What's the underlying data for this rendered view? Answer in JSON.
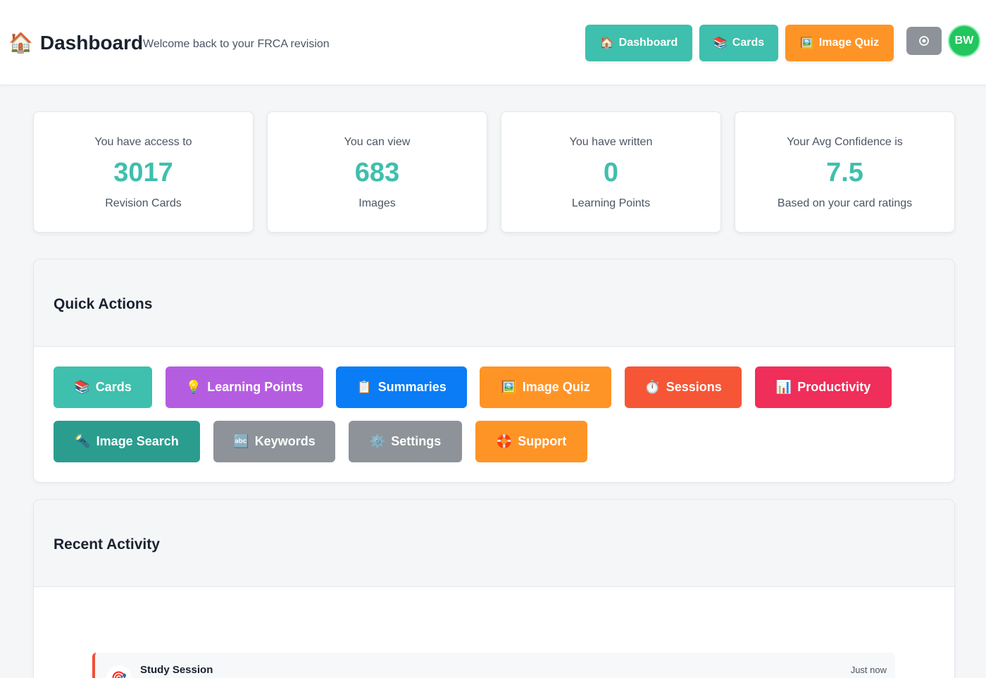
{
  "header": {
    "brand_icon": "🏠",
    "title": "Dashboard",
    "subtitle": "Welcome back to your FRCA revision",
    "nav": [
      {
        "icon": "🏠",
        "label": "Dashboard",
        "color": "#3fbfad"
      },
      {
        "icon": "📚",
        "label": "Cards",
        "color": "#3fbfad"
      },
      {
        "icon": "🖼️",
        "label": "Image Quiz",
        "color": "#ff9426"
      }
    ],
    "toggle_icon": "contrast-icon",
    "avatar_initials": "BW"
  },
  "stats": [
    {
      "label": "You have access to",
      "value": "3017",
      "caption": "Revision Cards"
    },
    {
      "label": "You can view",
      "value": "683",
      "caption": "Images"
    },
    {
      "label": "You have written",
      "value": "0",
      "caption": "Learning Points"
    },
    {
      "label": "Your Avg Confidence is",
      "value": "7.5",
      "caption": "Based on your card ratings"
    }
  ],
  "quick_actions": {
    "title": "Quick Actions",
    "buttons": [
      {
        "icon": "📚",
        "label": "Cards",
        "color": "#3fbfad"
      },
      {
        "icon": "💡",
        "label": "Learning Points",
        "color": "#b55de0"
      },
      {
        "icon": "📋",
        "label": "Summaries",
        "color": "#0a7cf5"
      },
      {
        "icon": "🖼️",
        "label": "Image Quiz",
        "color": "#ff9426"
      },
      {
        "icon": "⏱️",
        "label": "Sessions",
        "color": "#f65636"
      },
      {
        "icon": "📊",
        "label": "Productivity",
        "color": "#ef2e5a"
      },
      {
        "icon": "🔦",
        "label": "Image Search",
        "color": "#2a9d8f"
      },
      {
        "icon": "🔤",
        "label": "Keywords",
        "color": "#8e9399"
      },
      {
        "icon": "⚙️",
        "label": "Settings",
        "color": "#8e9399"
      },
      {
        "icon": "🛟",
        "label": "Support",
        "color": "#ff9426"
      }
    ]
  },
  "recent_activity": {
    "title": "Recent Activity",
    "items": [
      {
        "icon": "🎯",
        "title": "Study Session",
        "time": "Just now"
      }
    ]
  }
}
